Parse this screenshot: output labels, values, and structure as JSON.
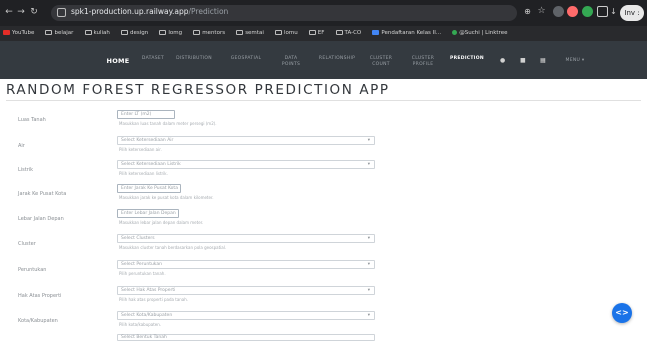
{
  "browser": {
    "url_host": "spk1-production.up.railway.app",
    "url_path": "/Prediction",
    "profile_label": "Inv :"
  },
  "bookmarks": [
    {
      "label": "YouTube",
      "type": "yt"
    },
    {
      "label": "belajar",
      "type": "folder"
    },
    {
      "label": "kuliah",
      "type": "folder"
    },
    {
      "label": "design",
      "type": "folder"
    },
    {
      "label": "lomg",
      "type": "folder"
    },
    {
      "label": "mentors",
      "type": "folder"
    },
    {
      "label": "semtai",
      "type": "folder"
    },
    {
      "label": "lomu",
      "type": "folder"
    },
    {
      "label": "EF",
      "type": "folder"
    },
    {
      "label": "TA-CO",
      "type": "folder"
    },
    {
      "label": "Pendaftaran Kelas II...",
      "type": "folder"
    },
    {
      "label": "@Suchi | Linktree",
      "type": "link"
    }
  ],
  "navbar": {
    "home": "HOME",
    "items": [
      {
        "l1": "DATASET",
        "l2": ""
      },
      {
        "l1": "DISTRIBUTION",
        "l2": ""
      },
      {
        "l1": "GEOSPATIAL",
        "l2": ""
      },
      {
        "l1": "DATA",
        "l2": "POINTS"
      },
      {
        "l1": "RELATIONSHIP",
        "l2": ""
      },
      {
        "l1": "CLUSTER",
        "l2": "COUNT"
      },
      {
        "l1": "CLUSTER",
        "l2": "PROFILE"
      },
      {
        "l1": "PREDICTION",
        "l2": ""
      }
    ],
    "menu": "MENU"
  },
  "page": {
    "title": "RANDOM FOREST REGRESSOR PREDICTION APP"
  },
  "form": [
    {
      "label": "Luas Tanah",
      "placeholder": "Enter LT (m2)",
      "help": "Masukkan luas tanah dalam meter persegi (m2)."
    },
    {
      "label": "Air",
      "placeholder": "Select Ketersediaan Air",
      "help": "Pilih ketersediaan air."
    },
    {
      "label": "Listrik",
      "placeholder": "Select Ketersediaan Listrik",
      "help": "Pilih ketersediaan listrik."
    },
    {
      "label": "Jarak Ke Pusat Kota",
      "placeholder": "Enter Jarak Ke Pusat Kota",
      "help": "Masukkan jarak ke pusat kota dalam kilometer."
    },
    {
      "label": "Lebar Jalan Depan",
      "placeholder": "Enter Lebar Jalan Depan",
      "help": "Masukkan lebar jalan depan dalam meter."
    },
    {
      "label": "Cluster",
      "placeholder": "Select Clusters",
      "help": "Masukkan cluster tanah berdasarkan pola geospatial."
    },
    {
      "label": "Peruntukan",
      "placeholder": "Select Peruntukan",
      "help": "Pilih peruntukan tanah."
    },
    {
      "label": "Hak Atas Properti",
      "placeholder": "Select Hak Atas Properti",
      "help": "Pilih hak atas properti pada tanah."
    },
    {
      "label": "Kota/Kabupaten",
      "placeholder": "Select Kota/Kabupaten",
      "help": "Pilih kota/kabupaten."
    },
    {
      "label": "",
      "placeholder": "Select Bentuk Tanah",
      "help": ""
    }
  ],
  "fab": {
    "glyph": "<>"
  }
}
